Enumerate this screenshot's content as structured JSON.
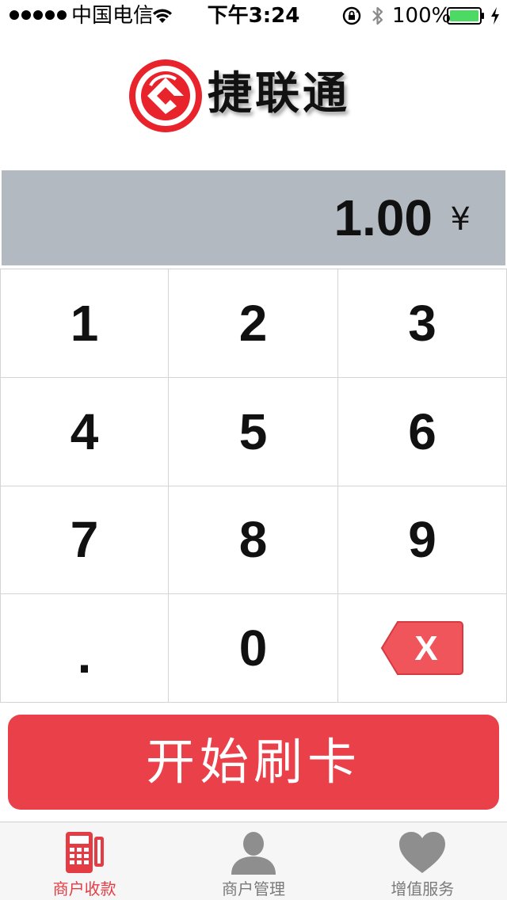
{
  "status_bar": {
    "carrier": "中国电信",
    "time": "下午3:24",
    "battery_percent": "100%",
    "icons": [
      "signal-dots-icon",
      "wifi-icon",
      "rotation-lock-icon",
      "bluetooth-icon",
      "battery-icon",
      "charging-icon"
    ]
  },
  "logo": {
    "text": "捷联通",
    "mark_icon": "red-swirl-logo"
  },
  "amount": {
    "value": "1.00",
    "currency": "¥"
  },
  "keypad": {
    "keys": [
      "1",
      "2",
      "3",
      "4",
      "5",
      "6",
      "7",
      "8",
      "9",
      ".",
      "0"
    ],
    "backspace_icon": "backspace-x-icon",
    "backspace_text": "X"
  },
  "swipe_button": {
    "label": "开始刷卡"
  },
  "tab_bar": {
    "tabs": [
      {
        "label": "商户收款",
        "icon": "pos-terminal-icon",
        "active": true
      },
      {
        "label": "商户管理",
        "icon": "user-icon",
        "active": false
      },
      {
        "label": "增值服务",
        "icon": "heart-icon",
        "active": false
      }
    ]
  },
  "colors": {
    "accent_red": "#e9404a",
    "amount_bar_bg": "#b3b9c0",
    "tab_active": "#e33c45",
    "tab_inactive": "#7a7a7a"
  }
}
